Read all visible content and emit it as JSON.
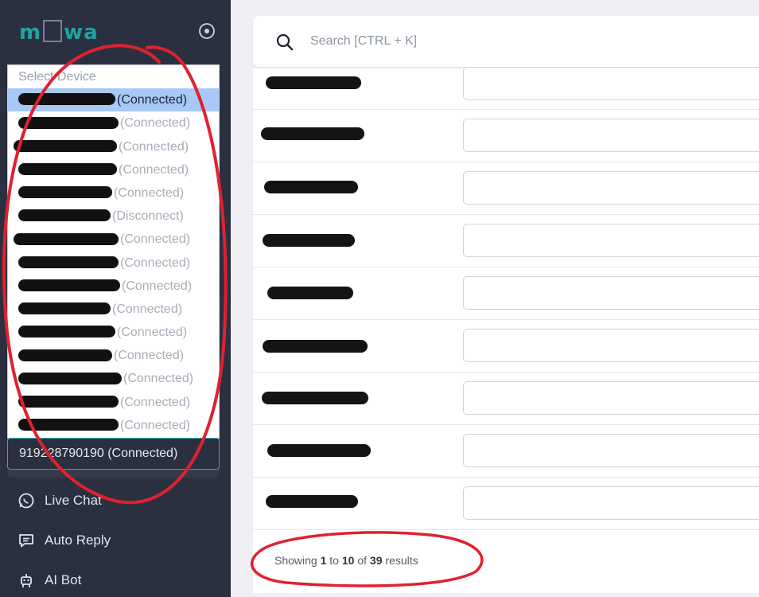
{
  "sidebar": {
    "logo_text": "MPWA",
    "device_select": {
      "placeholder": "Select Device",
      "options": [
        {
          "status": "(Connected)",
          "selected": true
        },
        {
          "status": "(Connected)"
        },
        {
          "status": "(Connected)"
        },
        {
          "status": "(Connected)"
        },
        {
          "status": "(Connected)"
        },
        {
          "status": "(Disconnect)"
        },
        {
          "status": "(Connected)"
        },
        {
          "status": "(Connected)"
        },
        {
          "status": "(Connected)"
        },
        {
          "status": "(Connected)"
        },
        {
          "status": "(Connected)"
        },
        {
          "status": "(Connected)"
        },
        {
          "status": "(Connected)"
        },
        {
          "status": "(Connected)"
        },
        {
          "status": "(Connected)"
        }
      ],
      "current_value": "919228790190 (Connected)"
    },
    "nav": [
      {
        "label": "Live Chat",
        "icon": "whatsapp-icon"
      },
      {
        "label": "Auto Reply",
        "icon": "message-icon"
      },
      {
        "label": "AI Bot",
        "icon": "robot-icon"
      }
    ]
  },
  "search": {
    "placeholder": "Search [CTRL + K]"
  },
  "footer": {
    "prefix": "Showing",
    "from": "1",
    "to_word": "to",
    "to": "10",
    "of_word": "of",
    "total": "39",
    "suffix": "results"
  },
  "colors": {
    "sidebar_bg": "#2b3040",
    "accent": "#20a39e",
    "annotation_red": "#e0212f"
  }
}
